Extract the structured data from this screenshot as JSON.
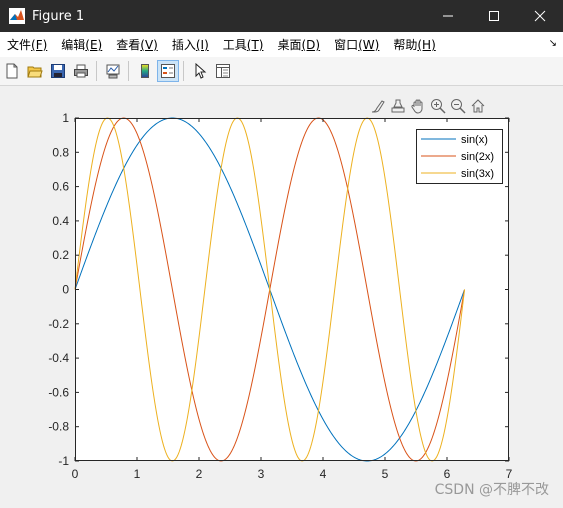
{
  "window": {
    "title": "Figure 1"
  },
  "menu": [
    {
      "label": "文件",
      "key": "(F)"
    },
    {
      "label": "编辑",
      "key": "(E)"
    },
    {
      "label": "查看",
      "key": "(V)"
    },
    {
      "label": "插入",
      "key": "(I)"
    },
    {
      "label": "工具",
      "key": "(T)"
    },
    {
      "label": "桌面",
      "key": "(D)"
    },
    {
      "label": "窗口",
      "key": "(W)"
    },
    {
      "label": "帮助",
      "key": "(H)"
    }
  ],
  "toolbar": {
    "icons": [
      "new-figure-icon",
      "open-file-icon",
      "save-icon",
      "print-icon",
      "link-plot-icon",
      "insert-colorbar-icon",
      "insert-legend-icon",
      "edit-plot-icon",
      "property-inspector-icon"
    ],
    "active": "insert-legend-icon"
  },
  "axes_toolbar": [
    "brush-icon",
    "data-tips-icon",
    "pan-icon",
    "zoom-in-icon",
    "zoom-out-icon",
    "home-icon"
  ],
  "chart_data": {
    "type": "line",
    "x_range": [
      0,
      6.2832
    ],
    "xlim": [
      0,
      7
    ],
    "ylim": [
      -1,
      1
    ],
    "xticks": [
      "0",
      "1",
      "2",
      "3",
      "4",
      "5",
      "6",
      "7"
    ],
    "yticks": [
      "1",
      "0.8",
      "0.6",
      "0.4",
      "0.2",
      "0",
      "-0.2",
      "-0.4",
      "-0.6",
      "-0.8",
      "-1"
    ],
    "grid": false,
    "legend_position": "top-right",
    "series": [
      {
        "name": "sin(x)",
        "color": "#0072BD",
        "frequency": 1
      },
      {
        "name": "sin(2x)",
        "color": "#D95319",
        "frequency": 2
      },
      {
        "name": "sin(3x)",
        "color": "#EDB120",
        "frequency": 3
      }
    ]
  },
  "watermark": "CSDN @不脾不改"
}
